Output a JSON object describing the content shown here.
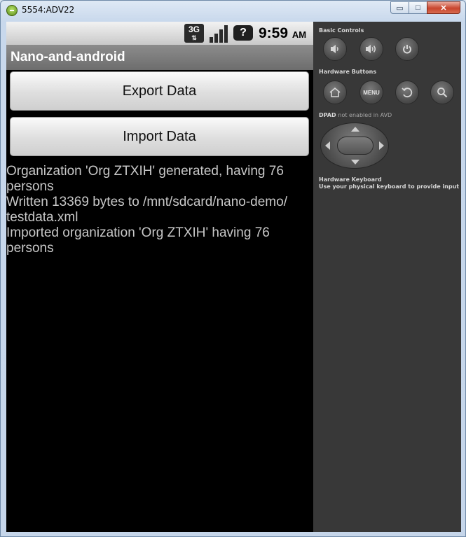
{
  "window": {
    "title": "5554:ADV22",
    "controls": {
      "minimize": "▭",
      "maximize": "□",
      "close": "✕"
    }
  },
  "status_bar": {
    "network": "3G",
    "network_arrows": "⇅",
    "help_badge": "?",
    "time": "9:59",
    "ampm": "AM"
  },
  "app": {
    "title": "Nano-and-android",
    "export_button": "Export Data",
    "import_button": "Import Data",
    "log_lines": [
      "Organization 'Org ZTXIH' generated, having 76 persons",
      "Written 13369 bytes to /mnt/sdcard/nano-demo/\ntestdata.xml",
      "Imported organization 'Org ZTXIH' having 76 persons"
    ]
  },
  "controls_panel": {
    "basic_controls_label": "Basic Controls",
    "hardware_buttons_label": "Hardware Buttons",
    "menu_label": "MENU",
    "dpad_label": "DPAD",
    "dpad_note": "not enabled in AVD",
    "keyboard_label": "Hardware Keyboard",
    "keyboard_note": "Use your physical keyboard to provide input",
    "icons": [
      "volume-down-icon",
      "volume-up-icon",
      "power-icon",
      "home-icon",
      "menu-icon",
      "back-icon",
      "search-icon"
    ]
  },
  "colors": {
    "screen_bg": "#000000",
    "log_text": "#c8c8c8",
    "panel_bg": "#383838",
    "title_bar_bg": "#7a7a7a"
  }
}
